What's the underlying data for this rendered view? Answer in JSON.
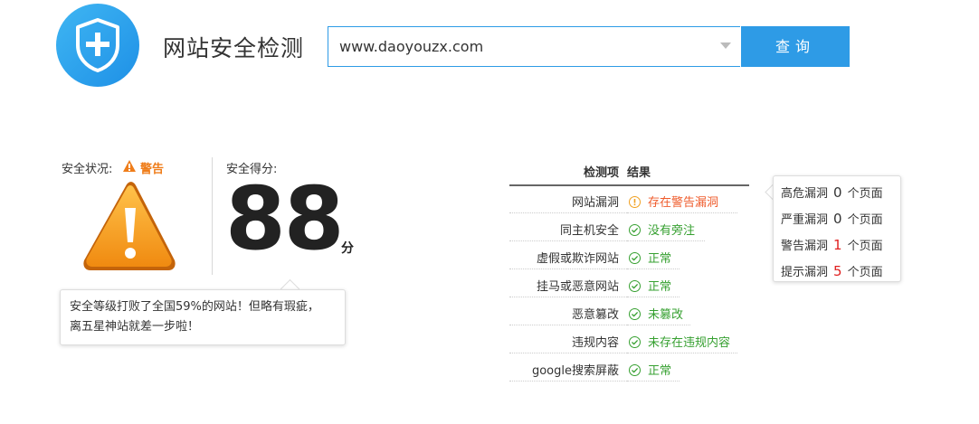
{
  "header": {
    "site_title": "网站安全检测",
    "search_value": "www.daoyouzx.com",
    "search_button": "查询"
  },
  "status": {
    "label": "安全状况:",
    "level": "警告",
    "score_label": "安全得分:",
    "score": "88",
    "score_unit": "分",
    "note_line1": "安全等级打败了全国59%的网站！但略有瑕疵，",
    "note_line2": "离五星神站就差一步啦！"
  },
  "table": {
    "col_item": "检测项",
    "col_result": "结果",
    "rows": [
      {
        "item": "网站漏洞",
        "result": "存在警告漏洞",
        "state": "warn"
      },
      {
        "item": "同主机安全",
        "result": "没有旁注",
        "state": "ok"
      },
      {
        "item": "虚假或欺诈网站",
        "result": "正常",
        "state": "ok"
      },
      {
        "item": "挂马或恶意网站",
        "result": "正常",
        "state": "ok"
      },
      {
        "item": "恶意篡改",
        "result": "未篡改",
        "state": "ok"
      },
      {
        "item": "违规内容",
        "result": "未存在违规内容",
        "state": "ok"
      },
      {
        "item": "google搜索屏蔽",
        "result": "正常",
        "state": "ok"
      }
    ]
  },
  "vulns": [
    {
      "label": "高危漏洞",
      "count": "0",
      "unit": "个页面",
      "highlight": false
    },
    {
      "label": "严重漏洞",
      "count": "0",
      "unit": "个页面",
      "highlight": false
    },
    {
      "label": "警告漏洞",
      "count": "1",
      "unit": "个页面",
      "highlight": true
    },
    {
      "label": "提示漏洞",
      "count": "5",
      "unit": "个页面",
      "highlight": true
    }
  ],
  "colors": {
    "accent": "#2e9be6",
    "warning": "#ef7d1a",
    "ok": "#36a030",
    "danger": "#e02020"
  }
}
